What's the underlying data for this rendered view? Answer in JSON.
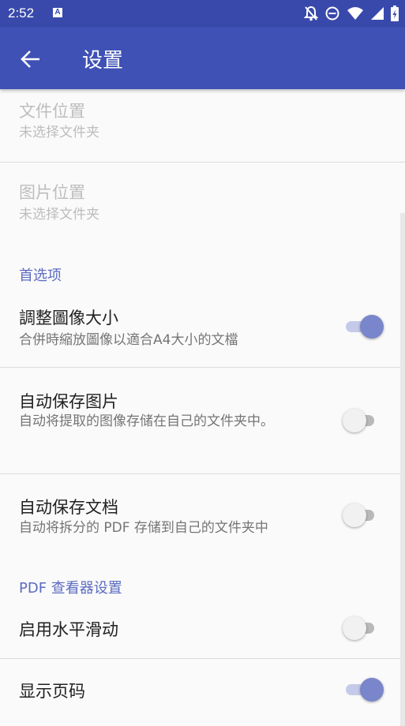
{
  "status_bar": {
    "time": "2:52",
    "notification_icon_letter": "A"
  },
  "app_bar": {
    "title": "设置",
    "back_icon": "arrow-back-icon"
  },
  "items": {
    "file_location": {
      "title": "文件位置",
      "summary": "未选择文件夹"
    },
    "image_location": {
      "title": "图片位置",
      "summary": "未选择文件夹"
    },
    "preferences_header": "首选项",
    "resize_images": {
      "title": "調整圖像大小",
      "summary": "合併時縮放圖像以適合A4大小的文檔",
      "checked": true
    },
    "auto_save_images": {
      "title": "自动保存图片",
      "summary": "自动将提取的图像存储在自己的文件夹中。",
      "checked": false
    },
    "auto_save_docs": {
      "title": "自动保存文档",
      "summary": "自动将拆分的 PDF 存储到自己的文件夹中",
      "checked": false
    },
    "pdf_viewer_header": "PDF 查看器设置",
    "horizontal_scroll": {
      "title": "启用水平滑动",
      "checked": false
    },
    "show_page_number": {
      "title": "显示页码",
      "checked": true
    }
  },
  "colors": {
    "app_bar": "#3f51b5",
    "status_bar": "#3949ab",
    "accent": "#7986cb",
    "category": "#5c6bc0"
  }
}
